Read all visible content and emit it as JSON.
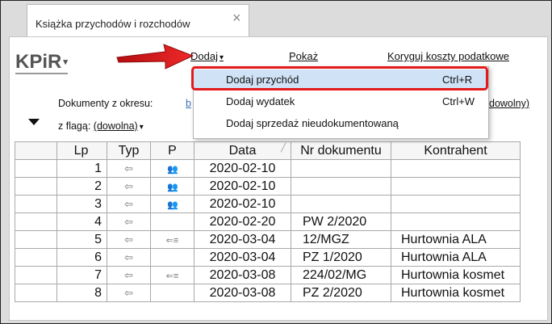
{
  "tab": {
    "title": "Książka przychodów i rozchodów",
    "close_glyph": "×"
  },
  "app": {
    "title": "KPiR",
    "title_caret": "▾"
  },
  "menu": {
    "dodaj_label": "Dodaj",
    "caret": "▾",
    "pokaz_label": "Pokaż",
    "koryguj_label": "Koryguj koszty podatkowe"
  },
  "filters": {
    "range_label": "Dokumenty z okresu:",
    "range_value_visible": "b",
    "range_tail_visible": "dowolny)",
    "flag_label": "z flagą:",
    "flag_value": "(dowolna)"
  },
  "dropdown": {
    "items": [
      {
        "label": "Dodaj przychód",
        "shortcut": "Ctrl+R",
        "selected": true
      },
      {
        "label": "Dodaj wydatek",
        "shortcut": "Ctrl+W",
        "selected": false
      },
      {
        "label": "Dodaj sprzedaż nieudokumentowaną",
        "shortcut": "",
        "selected": false
      }
    ]
  },
  "table": {
    "columns": [
      "",
      "Lp",
      "Typ",
      "P",
      "Data",
      "Nr dokumentu",
      "Kontrahent"
    ],
    "rows": [
      {
        "lp": "1",
        "typ": "⇦",
        "p": "people",
        "data": "2020-02-10",
        "nr": "",
        "kontrahent": ""
      },
      {
        "lp": "2",
        "typ": "⇦",
        "p": "people",
        "data": "2020-02-10",
        "nr": "",
        "kontrahent": ""
      },
      {
        "lp": "3",
        "typ": "⇦",
        "p": "people",
        "data": "2020-02-10",
        "nr": "",
        "kontrahent": ""
      },
      {
        "lp": "4",
        "typ": "⇦",
        "p": "",
        "data": "2020-02-20",
        "nr": "PW 2/2020",
        "kontrahent": ""
      },
      {
        "lp": "5",
        "typ": "⇦",
        "p": "list",
        "data": "2020-03-04",
        "nr": "12/MGZ",
        "kontrahent": "Hurtownia ALA"
      },
      {
        "lp": "6",
        "typ": "⇦",
        "p": "",
        "data": "2020-03-04",
        "nr": "PZ 1/2020",
        "kontrahent": "Hurtownia ALA"
      },
      {
        "lp": "7",
        "typ": "⇦",
        "p": "list",
        "data": "2020-03-08",
        "nr": "224/02/MG",
        "kontrahent": "Hurtownia kosmet"
      },
      {
        "lp": "8",
        "typ": "⇦",
        "p": "",
        "data": "2020-03-08",
        "nr": "PZ 2/2020",
        "kontrahent": "Hurtownia kosmet"
      }
    ]
  },
  "colors": {
    "highlight": "#e3191b",
    "selected_bg": "#cfe2f6",
    "link": "#3b6fb6"
  }
}
